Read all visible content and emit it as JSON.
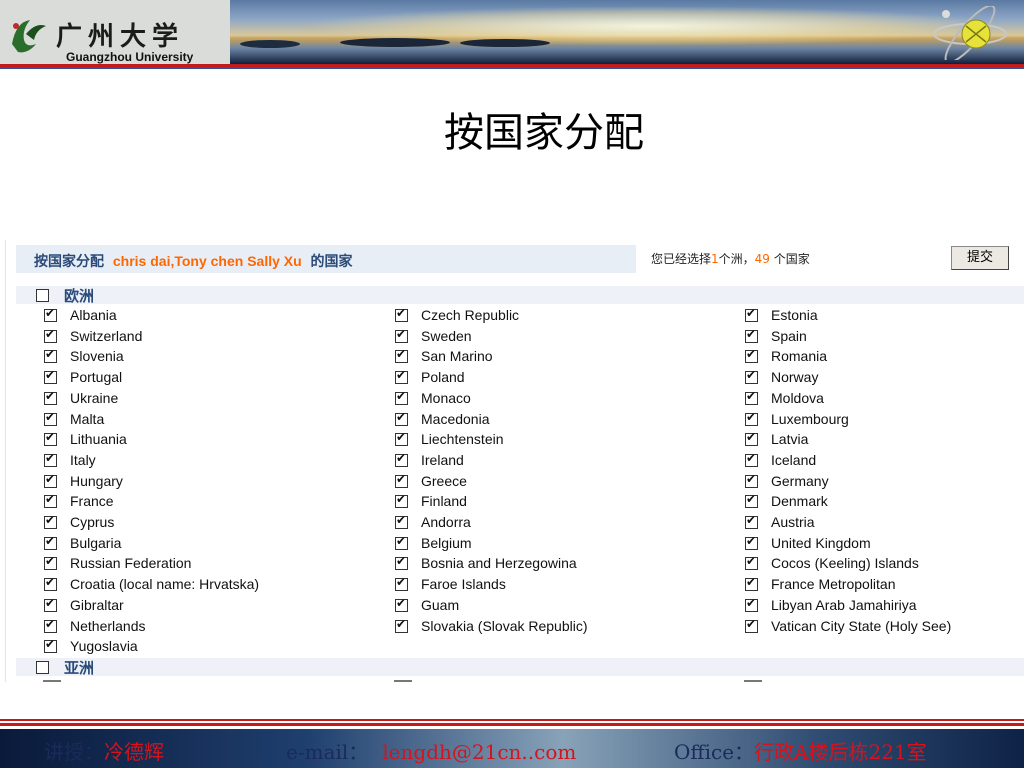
{
  "header": {
    "logo_cn": "广州大学",
    "logo_en": "Guangzhou University"
  },
  "slide_title": "按国家分配",
  "panel": {
    "title": "按国家分配",
    "names": "chris dai,Tony chen Sally Xu",
    "title_suffix": "的国家",
    "status_prefix": "您已经选择",
    "continents_selected": "1",
    "status_mid": "个洲，",
    "countries_selected": "49",
    "status_suffix": " 个国家",
    "submit_label": "提交"
  },
  "groups": [
    {
      "label": "欧洲",
      "checked": false,
      "columns": [
        [
          "Albania",
          "Switzerland",
          "Slovenia",
          "Portugal",
          "Ukraine",
          "Malta",
          "Lithuania",
          "Italy",
          "Hungary",
          "France",
          "Cyprus",
          "Bulgaria",
          "Russian Federation",
          "Croatia (local name: Hrvatska)",
          "Gibraltar",
          "Netherlands",
          "Yugoslavia"
        ],
        [
          "Czech Republic",
          "Sweden",
          "San Marino",
          "Poland",
          "Monaco",
          "Macedonia",
          "Liechtenstein",
          "Ireland",
          "Greece",
          "Finland",
          "Andorra",
          "Belgium",
          "Bosnia and Herzegowina",
          "Faroe Islands",
          "Guam",
          "Slovakia (Slovak Republic)"
        ],
        [
          "Estonia",
          "Spain",
          "Romania",
          "Norway",
          "Moldova",
          "Luxembourg",
          "Latvia",
          "Iceland",
          "Germany",
          "Denmark",
          "Austria",
          "United Kingdom",
          "Cocos (Keeling) Islands",
          "France Metropolitan",
          "Libyan Arab Jamahiriya",
          "Vatican City State (Holy See)"
        ]
      ]
    },
    {
      "label": "亚洲",
      "checked": false
    }
  ],
  "footer": {
    "teacher_label": "讲授：",
    "teacher": "冷德辉",
    "email_label": "e-mail：",
    "email": "lengdh@21cn..com",
    "office_label": "Office：",
    "office": "行政A楼后栋221室"
  },
  "colors": {
    "accent_orange": "#ff6600",
    "header_blue": "#2a4a7a",
    "rule_red": "#c31a1a"
  },
  "icons": [
    "university-emblem-icon",
    "orbit-globe-icon",
    "checkbox-checked-icon",
    "checkbox-unchecked-icon"
  ]
}
